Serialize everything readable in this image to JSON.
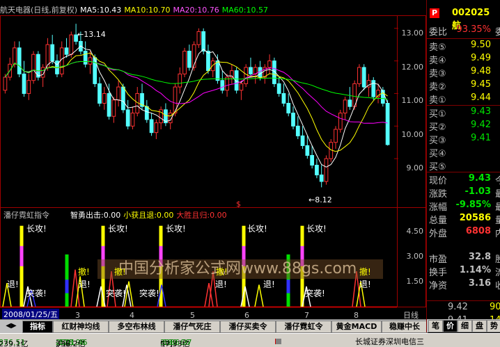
{
  "header": {
    "title": "航天电器(日线,前复权)",
    "ma5": "MA5:10.43",
    "ma10": "MA10:10.70",
    "ma20": "MA20:10.76",
    "ma60": "MA60:10.57",
    "colors": {
      "title": "#c0c0c0",
      "ma5": "#ffffff",
      "ma10": "#ffff00",
      "ma20": "#ff00ff",
      "ma60": "#00ff00"
    }
  },
  "price_axis": {
    "ticks": [
      "13.00",
      "12.00",
      "11.00",
      "10.00",
      "9.00"
    ],
    "high_label": "13.14",
    "low_label": "8.12",
    "marker": "$"
  },
  "indicator": {
    "title": "潘仔霓虹指令",
    "fields": [
      {
        "text": "智勇出击:0.00",
        "color": "#ffffff"
      },
      {
        "text": "小获且退:0.00",
        "color": "#ffff00"
      },
      {
        "text": "大胜且归:0.00",
        "color": "#ff3232"
      }
    ],
    "ticks": [
      "4.50",
      "3.00",
      "1.50"
    ],
    "annotations": {
      "attack": "长攻!",
      "retreat": "撤!",
      "exit": "退!",
      "raid": "突袭!"
    }
  },
  "x_axis": {
    "labels": [
      "3",
      "4",
      "5",
      "6",
      "7",
      "8"
    ],
    "period": "日线",
    "date": "2008/01/25/五"
  },
  "watermark": "中国分析家公式网www.88gs.com",
  "tabs": [
    "指标",
    "红财神均线",
    "多空布林线",
    "潘仔气死庄",
    "潘仔买卖令",
    "潘仔霓虹令",
    "黄金MACD",
    "稳赚中长"
  ],
  "quote_panel": {
    "badge": "P",
    "code": "002025",
    "name_short": "航",
    "ratio_label": "委比",
    "ratio_value": "93.35%",
    "ratio_suffix": "委",
    "asks": [
      {
        "label": "卖⑤",
        "price": "9.50"
      },
      {
        "label": "卖④",
        "price": "9.49"
      },
      {
        "label": "卖③",
        "price": "9.48"
      },
      {
        "label": "卖②",
        "price": "9.45"
      },
      {
        "label": "卖①",
        "price": "9.44"
      }
    ],
    "bids": [
      {
        "label": "买①",
        "price": "9.43"
      },
      {
        "label": "买②",
        "price": "9.42"
      },
      {
        "label": "买③",
        "price": "9.41"
      },
      {
        "label": "买④",
        "price": ""
      },
      {
        "label": "买⑤",
        "price": ""
      }
    ],
    "stats": [
      {
        "label": "现价",
        "value": "9.43",
        "suffix": "今",
        "color": "#00e600"
      },
      {
        "label": "涨跌",
        "value": "-1.03",
        "suffix": "最",
        "color": "#00e600"
      },
      {
        "label": "涨幅",
        "value": "-9.85%",
        "suffix": "最",
        "color": "#00e600"
      },
      {
        "label": "总量",
        "value": "20586",
        "suffix": "量",
        "color": "#ffff00"
      },
      {
        "label": "外盘",
        "value": "6808",
        "suffix": "内",
        "color": "#ff3232"
      },
      {
        "label": "市盈",
        "value": "32.8",
        "suffix": "股",
        "color": "#c0c0c0"
      },
      {
        "label": "换手",
        "value": "1.14%",
        "suffix": "流",
        "color": "#c0c0c0"
      },
      {
        "label": "净资",
        "value": "3.16",
        "suffix": "收",
        "color": "#c0c0c0"
      }
    ],
    "ticks": [
      {
        "price": "9.42",
        "vol": "90"
      },
      {
        "price": "9.41",
        "vol": "147"
      }
    ],
    "side_tabs": [
      "笔",
      "价",
      "细",
      "盘",
      "势"
    ]
  },
  "status_bar": {
    "sh": "876.51",
    "sh_amt": "239.1亿",
    "sz_label": "沪深",
    "sz": "2591.46",
    "sz_chg": "-128.98",
    "sz_amt": "336.2亿",
    "sme_label": "中小",
    "sme": "3386.27",
    "sme_chg": "-189.66",
    "sme_amt": "57.33亿",
    "broker": "长城证券深圳电信三"
  },
  "chart_data": {
    "type": "candlestick",
    "x_tick_labels": [
      "3",
      "4",
      "5",
      "6",
      "7",
      "8"
    ],
    "ylim": [
      8.0,
      13.4
    ],
    "high": 13.14,
    "low": 8.12,
    "last_close": 9.43,
    "candles": [
      [
        11.1,
        11.6,
        11.0,
        11.5
      ],
      [
        11.5,
        12.1,
        11.4,
        11.9
      ],
      [
        11.9,
        12.6,
        11.8,
        12.4
      ],
      [
        12.4,
        12.6,
        11.5,
        11.6
      ],
      [
        11.6,
        12.0,
        10.9,
        11.0
      ],
      [
        11.0,
        11.6,
        10.8,
        11.4
      ],
      [
        11.4,
        12.3,
        11.3,
        12.2
      ],
      [
        12.2,
        12.3,
        11.4,
        11.5
      ],
      [
        11.5,
        11.9,
        11.2,
        11.8
      ],
      [
        11.8,
        12.7,
        11.7,
        12.5
      ],
      [
        12.5,
        12.8,
        11.9,
        12.0
      ],
      [
        12.0,
        12.2,
        11.5,
        11.6
      ],
      [
        11.6,
        12.6,
        11.5,
        12.4
      ],
      [
        12.4,
        12.7,
        12.1,
        12.2
      ],
      [
        12.2,
        12.9,
        12.1,
        12.8
      ],
      [
        12.8,
        13.14,
        12.5,
        12.6
      ],
      [
        12.6,
        12.9,
        12.2,
        12.3
      ],
      [
        12.3,
        12.6,
        11.8,
        11.9
      ],
      [
        11.9,
        12.3,
        11.6,
        12.1
      ],
      [
        12.1,
        12.2,
        11.2,
        11.3
      ],
      [
        11.3,
        11.5,
        10.6,
        10.7
      ],
      [
        10.7,
        11.2,
        10.5,
        11.0
      ],
      [
        11.0,
        11.3,
        10.2,
        10.3
      ],
      [
        10.3,
        10.9,
        10.1,
        10.8
      ],
      [
        10.8,
        11.4,
        10.6,
        11.2
      ],
      [
        11.2,
        11.3,
        10.4,
        10.5
      ],
      [
        10.5,
        10.8,
        9.9,
        10.0
      ],
      [
        10.0,
        10.6,
        9.9,
        10.4
      ],
      [
        10.4,
        11.2,
        10.3,
        11.0
      ],
      [
        11.0,
        11.3,
        10.5,
        10.6
      ],
      [
        10.6,
        10.8,
        10.1,
        10.2
      ],
      [
        10.2,
        10.4,
        9.7,
        9.8
      ],
      [
        9.8,
        10.2,
        9.6,
        10.1
      ],
      [
        10.1,
        10.6,
        9.9,
        10.5
      ],
      [
        10.5,
        10.7,
        10.0,
        10.1
      ],
      [
        10.1,
        10.5,
        9.9,
        10.4
      ],
      [
        10.4,
        11.3,
        10.3,
        11.2
      ],
      [
        11.2,
        11.8,
        11.0,
        11.6
      ],
      [
        11.6,
        12.4,
        11.5,
        12.3
      ],
      [
        12.3,
        12.5,
        11.7,
        11.8
      ],
      [
        11.8,
        12.6,
        11.7,
        12.5
      ],
      [
        12.5,
        13.0,
        12.4,
        12.9
      ],
      [
        12.9,
        13.0,
        12.2,
        12.3
      ],
      [
        12.3,
        12.5,
        11.6,
        11.7
      ],
      [
        11.7,
        12.1,
        11.5,
        12.0
      ],
      [
        12.0,
        12.2,
        11.3,
        11.4
      ],
      [
        11.4,
        11.7,
        11.0,
        11.1
      ],
      [
        11.1,
        11.6,
        10.9,
        11.5
      ],
      [
        11.5,
        11.9,
        11.3,
        11.7
      ],
      [
        11.7,
        11.8,
        11.0,
        11.1
      ],
      [
        11.1,
        11.4,
        10.8,
        11.3
      ],
      [
        11.3,
        11.9,
        11.2,
        11.8
      ],
      [
        11.8,
        12.1,
        11.5,
        11.6
      ],
      [
        11.6,
        11.9,
        11.3,
        11.8
      ],
      [
        11.8,
        12.0,
        11.4,
        11.5
      ],
      [
        11.5,
        11.9,
        11.3,
        11.8
      ],
      [
        11.8,
        12.2,
        11.6,
        12.0
      ],
      [
        12.0,
        12.1,
        11.2,
        11.3
      ],
      [
        11.3,
        11.5,
        10.9,
        11.0
      ],
      [
        11.0,
        11.3,
        10.6,
        10.7
      ],
      [
        10.7,
        11.0,
        10.3,
        10.4
      ],
      [
        10.4,
        10.6,
        9.9,
        10.0
      ],
      [
        10.0,
        10.3,
        9.6,
        9.7
      ],
      [
        9.7,
        10.0,
        9.3,
        9.4
      ],
      [
        9.4,
        9.7,
        9.0,
        9.1
      ],
      [
        9.1,
        9.4,
        8.7,
        8.8
      ],
      [
        8.8,
        9.0,
        8.4,
        8.5
      ],
      [
        8.5,
        8.8,
        8.12,
        8.3
      ],
      [
        8.3,
        9.1,
        8.2,
        9.0
      ],
      [
        9.0,
        9.6,
        8.9,
        9.5
      ],
      [
        9.5,
        10.0,
        9.3,
        9.9
      ],
      [
        9.9,
        10.5,
        9.8,
        10.4
      ],
      [
        10.4,
        10.9,
        10.2,
        10.8
      ],
      [
        10.8,
        11.2,
        10.5,
        10.6
      ],
      [
        10.6,
        11.4,
        10.5,
        11.3
      ],
      [
        11.3,
        11.9,
        11.2,
        11.8
      ],
      [
        11.8,
        11.9,
        11.1,
        11.2
      ],
      [
        11.2,
        11.6,
        10.9,
        11.4
      ],
      [
        11.4,
        11.5,
        10.8,
        10.9
      ],
      [
        10.9,
        11.3,
        10.7,
        11.1
      ],
      [
        11.1,
        11.2,
        10.6,
        10.7
      ],
      [
        10.7,
        10.8,
        9.4,
        9.43
      ]
    ],
    "ma_series": [
      {
        "name": "MA5",
        "color": "#ffffff",
        "values": []
      },
      {
        "name": "MA10",
        "color": "#ffff00",
        "values": []
      },
      {
        "name": "MA20",
        "color": "#ff00ff",
        "values": []
      },
      {
        "name": "MA60",
        "color": "#00ff00",
        "values": []
      }
    ]
  }
}
